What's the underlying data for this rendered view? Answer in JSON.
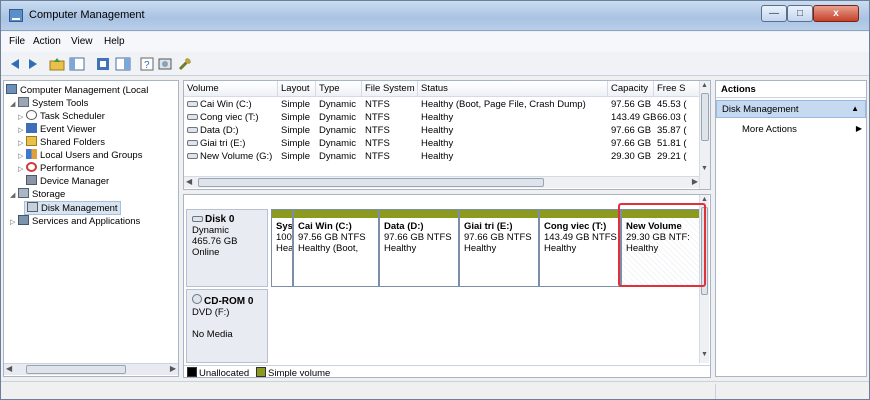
{
  "window": {
    "title": "Computer Management"
  },
  "menu": {
    "file": "File",
    "action": "Action",
    "view": "View",
    "help": "Help"
  },
  "tree": [
    {
      "label": "Computer Management (Local",
      "icon": "computer-icon"
    },
    {
      "label": "System Tools",
      "icon": "tools-icon"
    },
    {
      "label": "Task Scheduler",
      "icon": "clock-icon"
    },
    {
      "label": "Event Viewer",
      "icon": "event-viewer-icon"
    },
    {
      "label": "Shared Folders",
      "icon": "shared-folder-icon"
    },
    {
      "label": "Local Users and Groups",
      "icon": "users-icon"
    },
    {
      "label": "Performance",
      "icon": "performance-icon"
    },
    {
      "label": "Device Manager",
      "icon": "device-manager-icon"
    },
    {
      "label": "Storage",
      "icon": "storage-icon"
    },
    {
      "label": "Disk Management",
      "icon": "disk-management-icon"
    },
    {
      "label": "Services and Applications",
      "icon": "services-icon"
    }
  ],
  "volume_list": {
    "columns": [
      "Volume",
      "Layout",
      "Type",
      "File System",
      "Status",
      "Capacity",
      "Free S"
    ],
    "rows": [
      [
        "Cai Win (C:)",
        "Simple",
        "Dynamic",
        "NTFS",
        "Healthy (Boot, Page File, Crash Dump)",
        "97.56 GB",
        "45.53 ("
      ],
      [
        "Cong viec (T:)",
        "Simple",
        "Dynamic",
        "NTFS",
        "Healthy",
        "143.49 GB",
        "66.03 ("
      ],
      [
        "Data (D:)",
        "Simple",
        "Dynamic",
        "NTFS",
        "Healthy",
        "97.66 GB",
        "35.87 ("
      ],
      [
        "Giai tri (E:)",
        "Simple",
        "Dynamic",
        "NTFS",
        "Healthy",
        "97.66 GB",
        "51.81 ("
      ],
      [
        "New Volume (G:)",
        "Simple",
        "Dynamic",
        "NTFS",
        "Healthy",
        "29.30 GB",
        "29.21 ("
      ]
    ]
  },
  "disk0": {
    "name": "Disk 0",
    "type": "Dynamic",
    "size": "465.76 GB",
    "state": "Online"
  },
  "partitions": [
    {
      "name": "Syst",
      "size": "100",
      "status": "Hea"
    },
    {
      "name": "Cai Win  (C:)",
      "size": "97.56 GB NTFS",
      "status": "Healthy (Boot,"
    },
    {
      "name": "Data  (D:)",
      "size": "97.66 GB NTFS",
      "status": "Healthy"
    },
    {
      "name": "Giai tri  (E:)",
      "size": "97.66 GB NTFS",
      "status": "Healthy"
    },
    {
      "name": "Cong viec  (T:)",
      "size": "143.49 GB NTFS",
      "status": "Healthy"
    },
    {
      "name": "New Volume",
      "size": "29.30 GB NTF:",
      "status": "Healthy"
    }
  ],
  "cdrom": {
    "name": "CD-ROM 0",
    "drive": "DVD (F:)",
    "media": "No Media"
  },
  "legend": {
    "unallocated": "Unallocated",
    "simple": "Simple volume"
  },
  "actions": {
    "header": "Actions",
    "section": "Disk Management",
    "more": "More Actions"
  },
  "colors": {
    "volume_bar": "#8c9a20",
    "highlight": "#e0303a",
    "selection": "#c5d9f1"
  }
}
